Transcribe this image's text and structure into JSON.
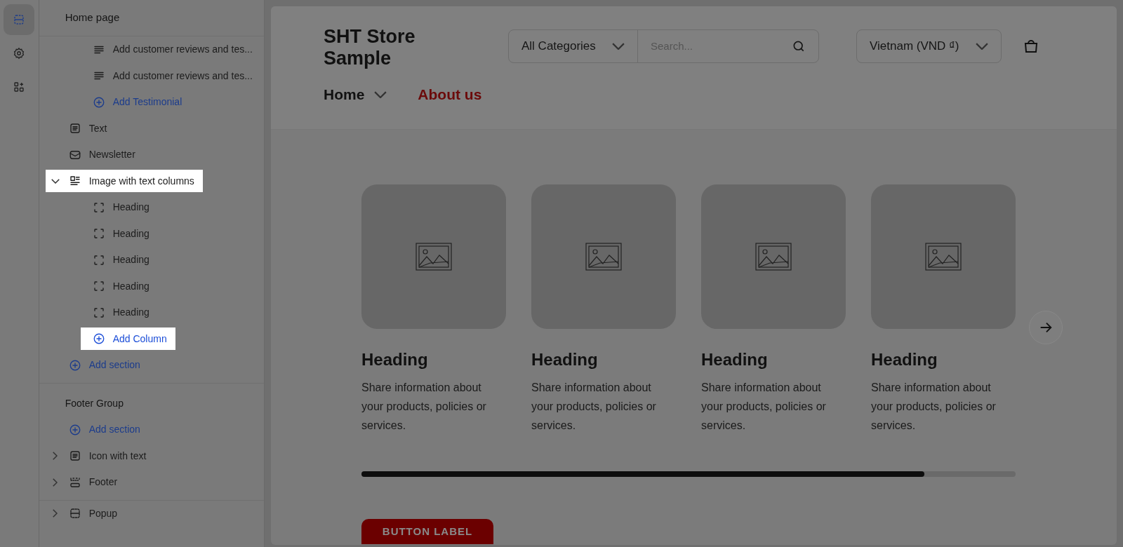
{
  "rail": [
    {
      "kind": "sections",
      "selected": true
    },
    {
      "kind": "settings",
      "selected": false
    },
    {
      "kind": "apps",
      "selected": false
    }
  ],
  "sidebar": {
    "title": "Home page",
    "groups": [
      {
        "items": [
          {
            "kind": "continuation",
            "children": [
              {
                "kind": "lines",
                "label": "Add customer reviews and tes...",
                "highlighted": false
              },
              {
                "kind": "lines",
                "label": "Add customer reviews and tes...",
                "highlighted": false
              },
              {
                "kind": "add",
                "label": "Add Testimonial",
                "highlighted": false
              }
            ]
          },
          {
            "kind": "text-block",
            "label": "Text",
            "highlighted": false
          },
          {
            "kind": "newsletter",
            "label": "Newsletter",
            "highlighted": false
          },
          {
            "kind": "columns",
            "label": "Image with text columns",
            "expanded": true,
            "highlighted": true,
            "children": [
              {
                "kind": "block",
                "label": "Heading",
                "highlighted": false
              },
              {
                "kind": "block",
                "label": "Heading",
                "highlighted": false
              },
              {
                "kind": "block",
                "label": "Heading",
                "highlighted": false
              },
              {
                "kind": "block",
                "label": "Heading",
                "highlighted": false
              },
              {
                "kind": "block",
                "label": "Heading",
                "highlighted": false
              },
              {
                "kind": "add",
                "label": "Add Column",
                "highlighted": true
              }
            ]
          },
          {
            "kind": "add",
            "label": "Add section",
            "highlighted": false
          }
        ]
      },
      {
        "title": "Footer Group",
        "items": [
          {
            "kind": "add",
            "label": "Add section",
            "highlighted": false
          },
          {
            "kind": "text-block",
            "label": "Icon with text",
            "expanded": false,
            "highlighted": false
          },
          {
            "kind": "footer",
            "label": "Footer",
            "expanded": false,
            "highlighted": false
          }
        ]
      },
      {
        "items": [
          {
            "kind": "popup",
            "label": "Popup",
            "expanded": false,
            "highlighted": false
          }
        ]
      }
    ]
  },
  "preview": {
    "store_name": "SHT Store Sample",
    "category_select": "All Categories",
    "search": {
      "placeholder": "Search..."
    },
    "currency_select": "Vietnam (VND ₫)",
    "nav": [
      {
        "label": "Home",
        "dropdown": true,
        "color": "#111111"
      },
      {
        "label": "About us",
        "dropdown": false,
        "color": "#6b0a0a"
      }
    ],
    "cards": [
      {
        "heading": "Heading",
        "text": "Share information about your products, policies or services."
      },
      {
        "heading": "Heading",
        "text": "Share information about your products, policies or services."
      },
      {
        "heading": "Heading",
        "text": "Share information about your products, policies or services."
      },
      {
        "heading": "Heading",
        "text": "Share information about your products, policies or services."
      }
    ],
    "carousel": {
      "level": 0.86
    },
    "button": "BUTTON LABEL"
  }
}
